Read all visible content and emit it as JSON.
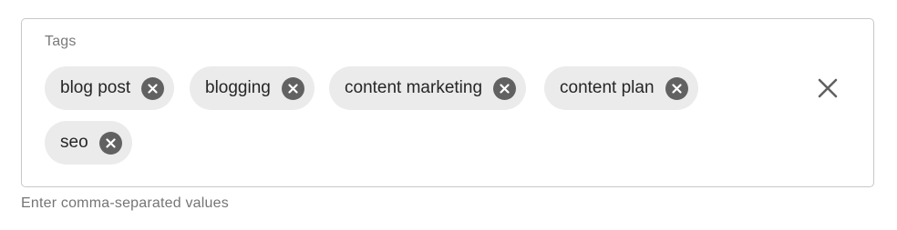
{
  "field": {
    "label": "Tags",
    "helper_text": "Enter comma-separated values",
    "chips": [
      {
        "label": "blog post",
        "remove_icon": "cancel-circle-icon"
      },
      {
        "label": "blogging",
        "remove_icon": "cancel-circle-icon"
      },
      {
        "label": "content marketing",
        "remove_icon": "cancel-circle-icon"
      },
      {
        "label": "content plan",
        "remove_icon": "cancel-circle-icon"
      },
      {
        "label": "seo",
        "remove_icon": "cancel-circle-icon"
      }
    ],
    "clear_icon": "close-icon"
  },
  "colors": {
    "chip_background": "#ebebeb",
    "chip_text": "#262626",
    "remove_icon": "#616161",
    "border": "#c8c8c8",
    "secondary_text": "#757575"
  }
}
